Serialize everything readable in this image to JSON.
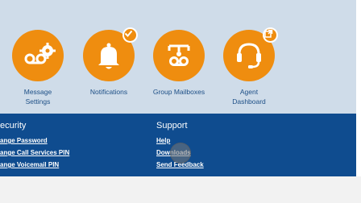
{
  "tiles": [
    {
      "icon": "voicemail-gear-icon",
      "label": "Message Settings",
      "badge": null
    },
    {
      "icon": "bell-icon",
      "label": "Notifications",
      "badge": "checkmark-badge-icon"
    },
    {
      "icon": "group-mailbox-icon",
      "label": "Group Mailboxes",
      "badge": null
    },
    {
      "icon": "headset-icon",
      "label": "Agent Dashboard",
      "badge": "external-link-badge-icon"
    }
  ],
  "footer": {
    "security": {
      "title": "ecurity",
      "links": [
        "ange Password",
        "ange Call Services PIN",
        "ange Voicemail PIN"
      ]
    },
    "support": {
      "title": "Support",
      "links": [
        "Help",
        "Downloads",
        "Send Feedback"
      ]
    }
  },
  "colors": {
    "accent": "#ef8d0f",
    "footer_bg": "#0f4c8f",
    "top_bg": "#cfdce9",
    "label": "#1d4f86"
  }
}
